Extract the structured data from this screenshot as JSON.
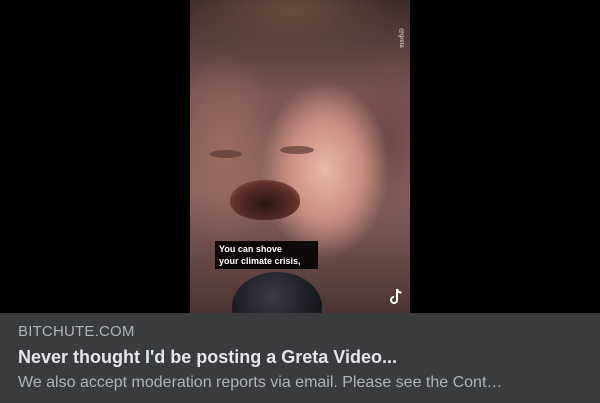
{
  "link_card": {
    "media": {
      "caption_line1": "You can shove",
      "caption_line2": "your climate crisis,",
      "watermark_vertical": "@greta",
      "icon": "tiktok-icon"
    },
    "domain": "BITCHUTE.COM",
    "title": "Never thought I'd be posting a Greta Video...",
    "description": "We also accept moderation reports via email. Please see the Cont…"
  },
  "colors": {
    "footer_background": "#3a3b3c",
    "title_text": "#e4e6eb",
    "secondary_text": "#b0b3b8",
    "media_background": "#000000"
  }
}
